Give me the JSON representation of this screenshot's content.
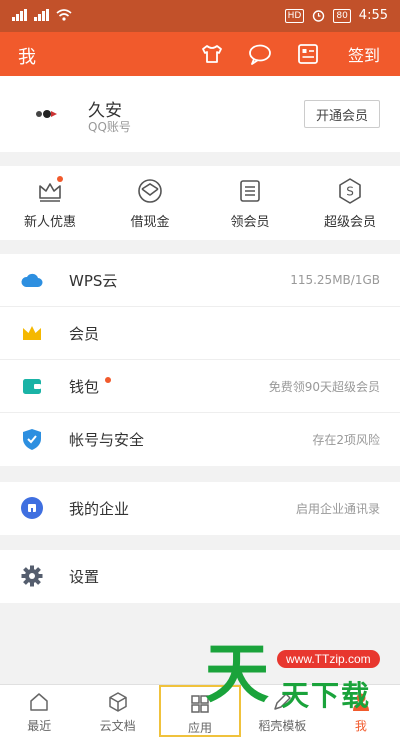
{
  "status_bar": {
    "left_text": "",
    "battery": "80",
    "time": "4:55"
  },
  "app_bar": {
    "title": "我",
    "signin_label": "签到",
    "icons": [
      "shirt-icon",
      "chat-bubble-icon",
      "card-icon"
    ]
  },
  "profile": {
    "name": "久安",
    "account_type": "QQ账号",
    "vip_button": "开通会员"
  },
  "quick_actions": [
    {
      "label": "新人优惠",
      "icon": "crown-icon",
      "has_dot": true
    },
    {
      "label": "借现金",
      "icon": "money-icon",
      "has_dot": false
    },
    {
      "label": "领会员",
      "icon": "list-card-icon",
      "has_dot": false
    },
    {
      "label": "超级会员",
      "icon": "hexagon-dollar-icon",
      "has_dot": false
    }
  ],
  "menu_group_1": [
    {
      "label": "WPS云",
      "value": "115.25MB/1GB",
      "icon": "cloud-icon",
      "color": "#2d8fe0"
    },
    {
      "label": "会员",
      "value": "",
      "icon": "crown-icon",
      "color": "#f5b800"
    },
    {
      "label": "钱包",
      "value": "免费领90天超级会员",
      "icon": "wallet-icon",
      "color": "#1ab3a6",
      "has_dot": true
    },
    {
      "label": "帐号与安全",
      "value": "存在2项风险",
      "icon": "shield-check-icon",
      "color": "#2d8fe0"
    }
  ],
  "menu_group_2": [
    {
      "label": "我的企业",
      "value": "启用企业通讯录",
      "icon": "building-icon",
      "color": "#3f6fe0"
    }
  ],
  "menu_group_3": [
    {
      "label": "设置",
      "value": "",
      "icon": "gear-icon",
      "color": "#555e6e"
    }
  ],
  "bottom_nav": [
    {
      "label": "最近",
      "icon": "home-icon",
      "active": false
    },
    {
      "label": "云文档",
      "icon": "cube-icon",
      "active": false
    },
    {
      "label": "应用",
      "icon": "grid-icon",
      "active": false
    },
    {
      "label": "稻壳模板",
      "icon": "pen-icon",
      "active": false
    },
    {
      "label": "我",
      "icon": "person-icon",
      "active": true
    }
  ],
  "watermark": {
    "big": "天",
    "url": "www.TTzip.com",
    "sub": "天下载"
  },
  "colors": {
    "accent": "#f15a2c",
    "status_bar": "#c2512a",
    "background": "#f2f2f2"
  }
}
